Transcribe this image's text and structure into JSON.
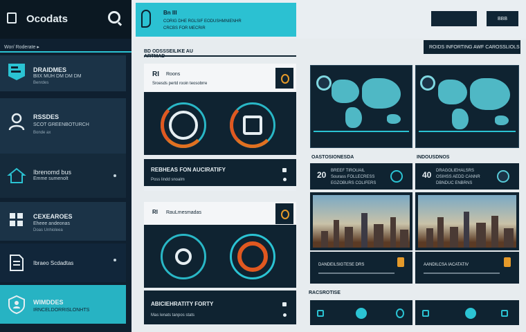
{
  "app": {
    "title": "Ocodats",
    "breadcrumb": "Wor/ Roderate ▸"
  },
  "sidebar": {
    "items": [
      {
        "title": "DRAIDMES",
        "line1": "BIIX MUH DM DM DM",
        "line2": "Benrdes"
      },
      {
        "title": "RSSDES",
        "line1": "SCOT GREENBOTURCH",
        "line2": "Bonde ax"
      },
      {
        "title": "Ibrenomd bus",
        "line1": "Emme sumenolt",
        "line2": ""
      },
      {
        "title": "CEXEAROES",
        "line1": "Eheee andeonas",
        "line2": "Doas Unhioleea"
      },
      {
        "title": "Ibraeo Scdadtas",
        "line1": "",
        "line2": ""
      },
      {
        "title": "WIMDDES",
        "line1": "IRNCELDORRISLONHTS",
        "line2": ""
      }
    ]
  },
  "topbar": {
    "card_title": "Bn III",
    "card_line1": "CORIG DHE RGLSIF EODUSHMNIENHR",
    "card_line2": "CRCBS FOR MECRIR",
    "btn1": "",
    "btn2": "BBB"
  },
  "main": {
    "strip_left": "BD ODSSSEILIKE AU ARTMAD",
    "strip_right": "ROIDS INFORTING AWF CAROSSLIOLS",
    "panel1": {
      "num": "RI",
      "name": "Roons",
      "sub": "Sroesds pertd rooin teosobrre"
    },
    "bar1": {
      "title": "REBHEAS FON AUCIRATIFY",
      "sub": "Poss lindd snoalm"
    },
    "panel2": {
      "num": "RI",
      "name": "RauLmesmadas"
    },
    "bar2": {
      "title": "ABICIEHRATITY FORTY",
      "sub": "Mas lenats tanpos stats"
    },
    "sec1": "OASTOSIONESDA",
    "sec2": "INDOUSDNOS",
    "card1": {
      "num": "20",
      "l1": "BREEF TIROUAIL",
      "l2": "Sourass FOLLECRESS",
      "l3": "EGZOBURS COLIFERS"
    },
    "card2": {
      "num": "40",
      "l1": "DRAGOLIEHALSRS",
      "l2": "OSIHSS AEDD CANNR",
      "l3": "DBNDUC ENBRNS"
    },
    "caption1": "DANDEILSIGTESE DRS",
    "caption2": "AANDILCSA IACATATIV",
    "sec3": "RACSROTISE"
  },
  "colors": {
    "accent": "#2bc3d3",
    "dark": "#0f2331",
    "orange": "#e07020"
  }
}
